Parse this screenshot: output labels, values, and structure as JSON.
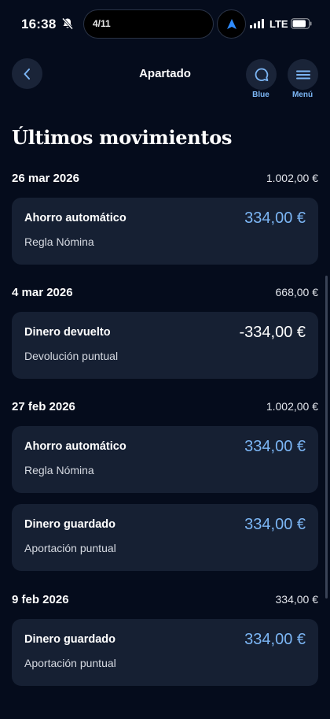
{
  "status_bar": {
    "time": "16:38",
    "island_text": "4/11",
    "network": "LTE",
    "icons": [
      "bell-off-icon",
      "navigation-arrow-icon",
      "signal-icon",
      "battery-icon"
    ]
  },
  "header": {
    "title": "Apartado",
    "blue_label": "Blue",
    "menu_label": "Menú"
  },
  "section_title": "Últimos movimientos",
  "groups": [
    {
      "date": "26 mar 2026",
      "total": "1.002,00 €",
      "items": [
        {
          "title": "Ahorro automático",
          "subtitle": "Regla Nómina",
          "amount": "334,00 €"
        }
      ]
    },
    {
      "date": "4 mar 2026",
      "total": "668,00 €",
      "items": [
        {
          "title": "Dinero devuelto",
          "subtitle": "Devolución puntual",
          "amount": "-334,00 €"
        }
      ]
    },
    {
      "date": "27 feb 2026",
      "total": "1.002,00 €",
      "items": [
        {
          "title": "Ahorro automático",
          "subtitle": "Regla Nómina",
          "amount": "334,00 €"
        },
        {
          "title": "Dinero guardado",
          "subtitle": "Aportación puntual",
          "amount": "334,00 €"
        }
      ]
    },
    {
      "date": "9 feb 2026",
      "total": "334,00 €",
      "items": [
        {
          "title": "Dinero guardado",
          "subtitle": "Aportación puntual",
          "amount": "334,00 €"
        }
      ]
    }
  ],
  "colors": {
    "background": "#050c1c",
    "card": "#162033",
    "accent_blue": "#7cb6f5",
    "button_bg": "#1a2438"
  }
}
